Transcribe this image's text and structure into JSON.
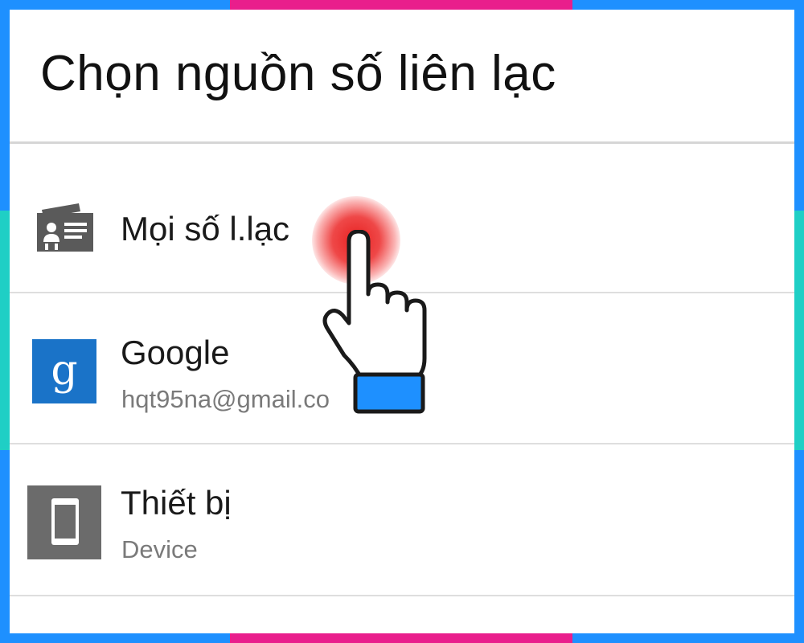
{
  "dialog": {
    "title": "Chọn nguồn số liên lạc"
  },
  "items": [
    {
      "label": "Mọi số l.lạc",
      "sub": "",
      "icon": "contact-card-icon"
    },
    {
      "label": "Google",
      "sub": "hqt95na@gmail.co",
      "icon": "google-icon"
    },
    {
      "label": "Thiết bị",
      "sub": "Device",
      "icon": "phone-device-icon"
    }
  ],
  "overlay": {
    "pointer_icon": "hand-pointer-icon",
    "touch_color": "#e31b1b",
    "cuff_color": "#1e90ff"
  },
  "colors": {
    "frame": "#1e90ff",
    "frame_accent_pink": "#e91e8c",
    "frame_accent_teal": "#1fcfc5",
    "google_blue": "#1a73c8",
    "device_gray": "#6b6b6b"
  }
}
